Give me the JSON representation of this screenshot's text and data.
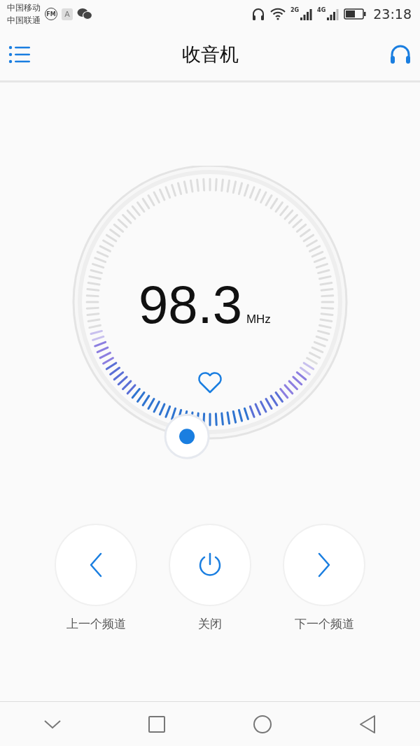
{
  "status_bar": {
    "carriers": [
      "中国移动",
      "中国联通"
    ],
    "fm_badge": "FM",
    "keyboard_badge": "A",
    "network_2g": "2G",
    "network_4g": "4G",
    "time": "23:18"
  },
  "header": {
    "title": "收音机"
  },
  "tuner": {
    "frequency": "98.3",
    "unit": "MHz",
    "favorite": false
  },
  "controls": [
    {
      "kind": "prev",
      "label": "上一个频道"
    },
    {
      "kind": "power",
      "label": "关闭"
    },
    {
      "kind": "next",
      "label": "下一个频道"
    }
  ]
}
